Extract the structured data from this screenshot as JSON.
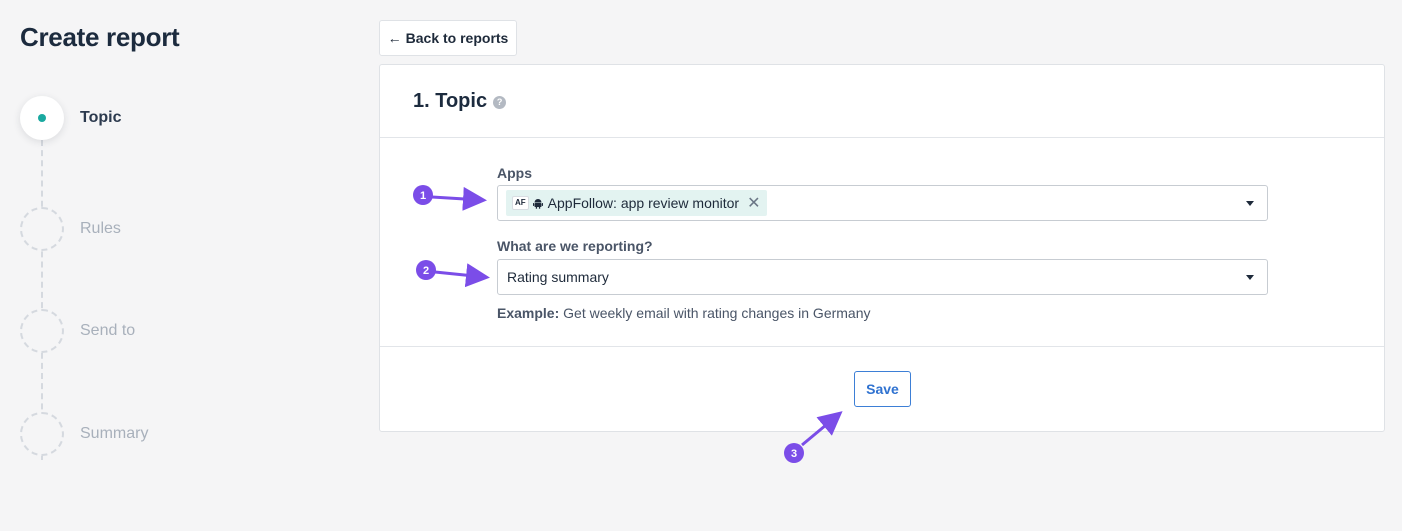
{
  "page": {
    "title": "Create report"
  },
  "steps": [
    {
      "label": "Topic",
      "active": true
    },
    {
      "label": "Rules",
      "active": false
    },
    {
      "label": "Send to",
      "active": false
    },
    {
      "label": "Summary",
      "active": false
    }
  ],
  "back_button": {
    "arrow": "←",
    "label": "Back to reports"
  },
  "card": {
    "title": "1. Topic",
    "help_glyph": "?",
    "apps": {
      "label": "Apps",
      "chip": {
        "prefix": "AF",
        "name": "AppFollow: app review monitor",
        "remove_glyph": "✕"
      }
    },
    "reporting": {
      "label": "What are we reporting?",
      "value": "Rating summary"
    },
    "example": {
      "prefix": "Example:",
      "text": "Get weekly email with rating changes in Germany"
    },
    "save_label": "Save"
  },
  "annotations": {
    "color": "#7b4de8",
    "badges": [
      "1",
      "2",
      "3"
    ]
  },
  "colors": {
    "accent_teal": "#1aa9a0",
    "chip_bg": "#e3f3f1",
    "primary_blue": "#2f72d0",
    "annotation_purple": "#7b4de8"
  }
}
